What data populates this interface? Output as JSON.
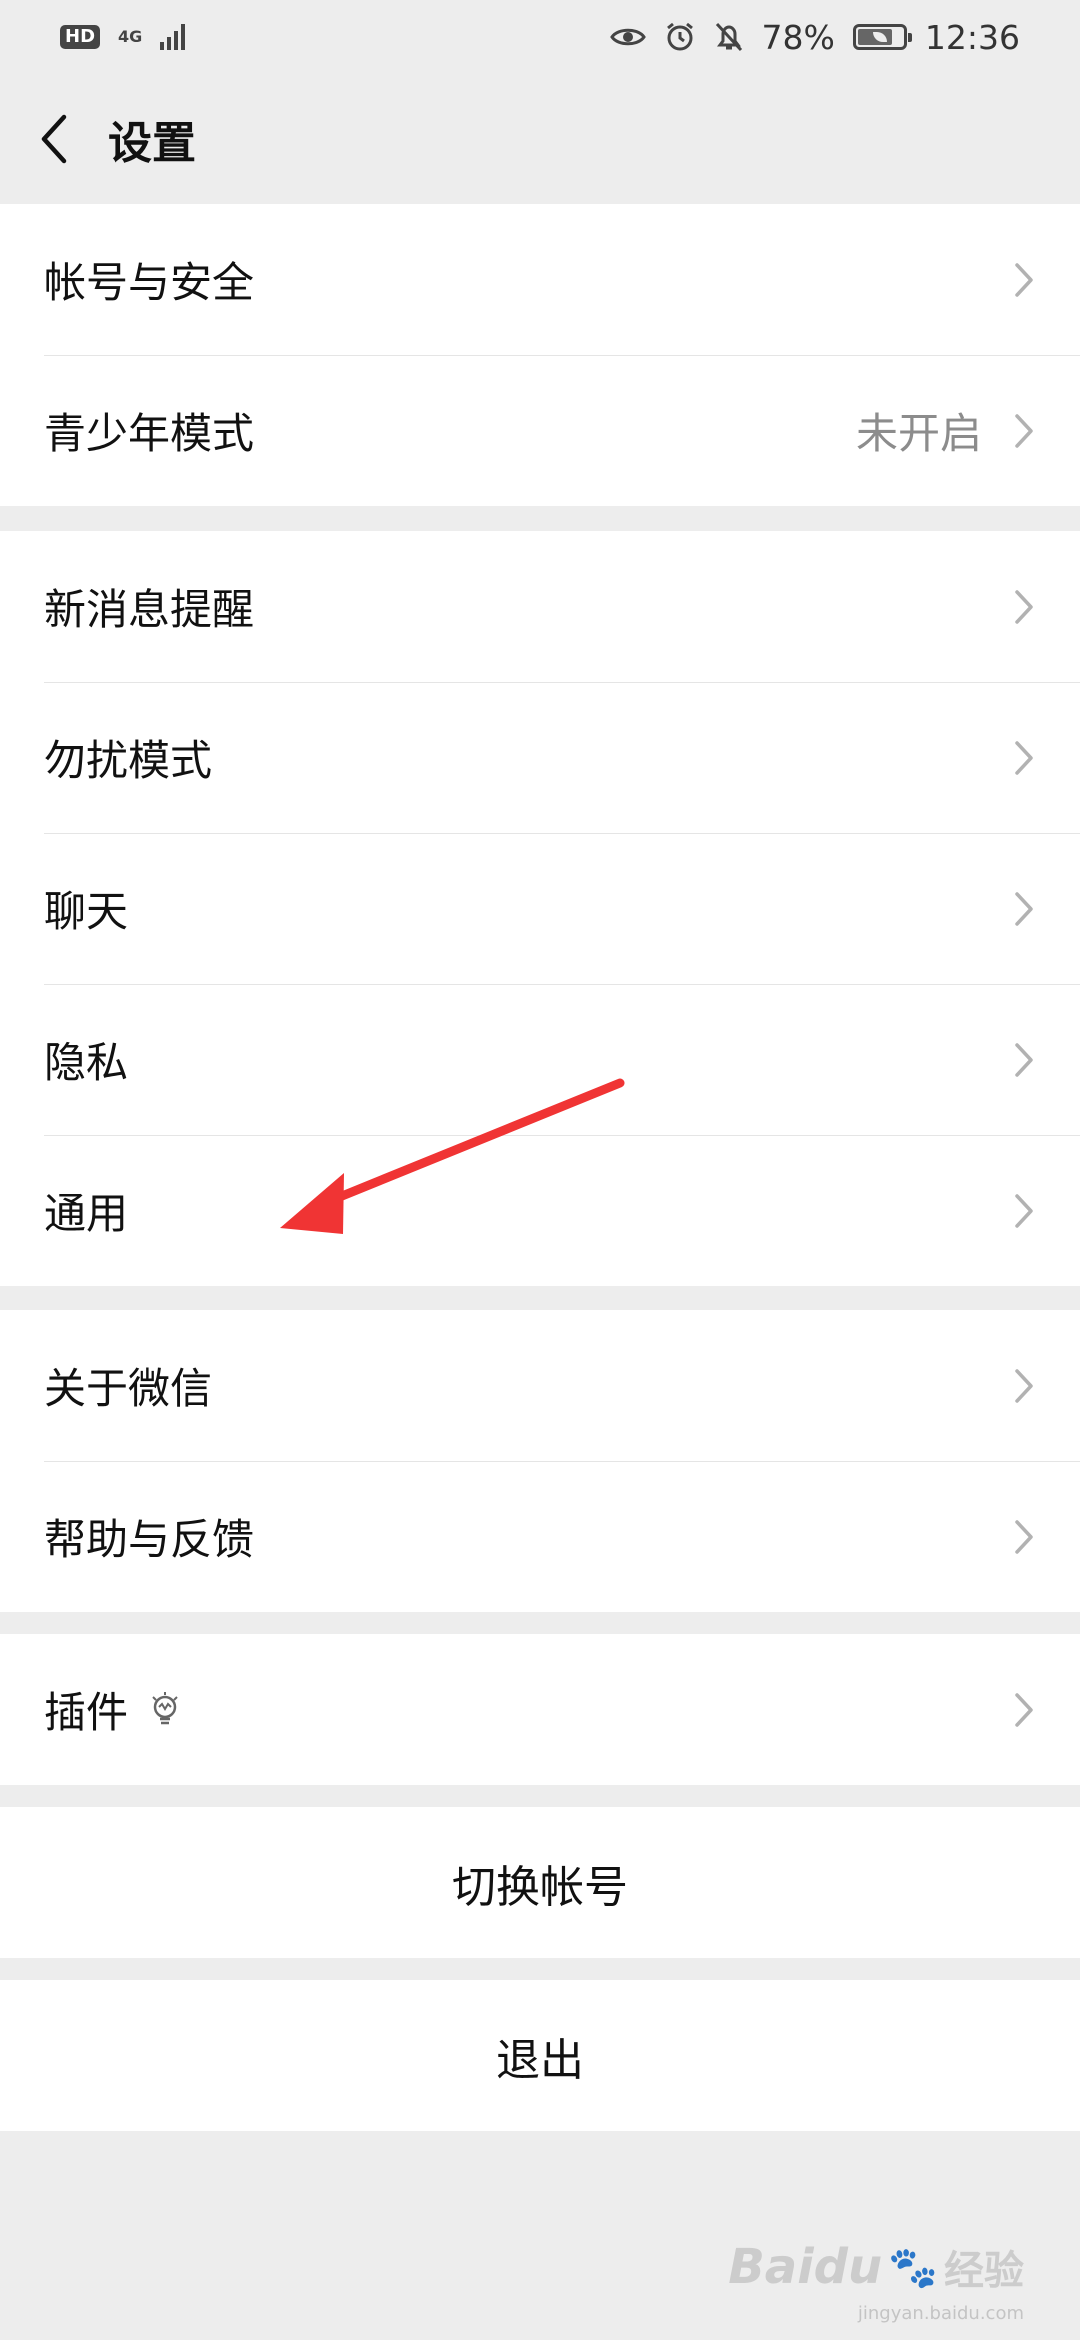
{
  "status_bar": {
    "hd": "HD",
    "network": "4G",
    "battery": "78%",
    "time": "12:36",
    "icons": [
      "eye-icon",
      "alarm-icon",
      "bell-off-icon"
    ]
  },
  "header": {
    "title": "设置",
    "back_icon": "chevron-left-icon"
  },
  "groups": {
    "account": {
      "security": "帐号与安全",
      "teen_mode": "青少年模式",
      "teen_mode_value": "未开启"
    },
    "settings": {
      "notifications": "新消息提醒",
      "dnd": "勿扰模式",
      "chat": "聊天",
      "privacy": "隐私",
      "general": "通用"
    },
    "about": {
      "about_wechat": "关于微信",
      "help": "帮助与反馈"
    },
    "plugins": {
      "label": "插件",
      "icon": "lightbulb-icon"
    },
    "switch_account": "切换帐号",
    "logout": "退出"
  },
  "annotation": {
    "arrow_color": "#f03434",
    "points_to": "general"
  },
  "watermark": {
    "brand": "Baidu",
    "cn": "经验",
    "sub": "jingyan.baidu.com"
  }
}
